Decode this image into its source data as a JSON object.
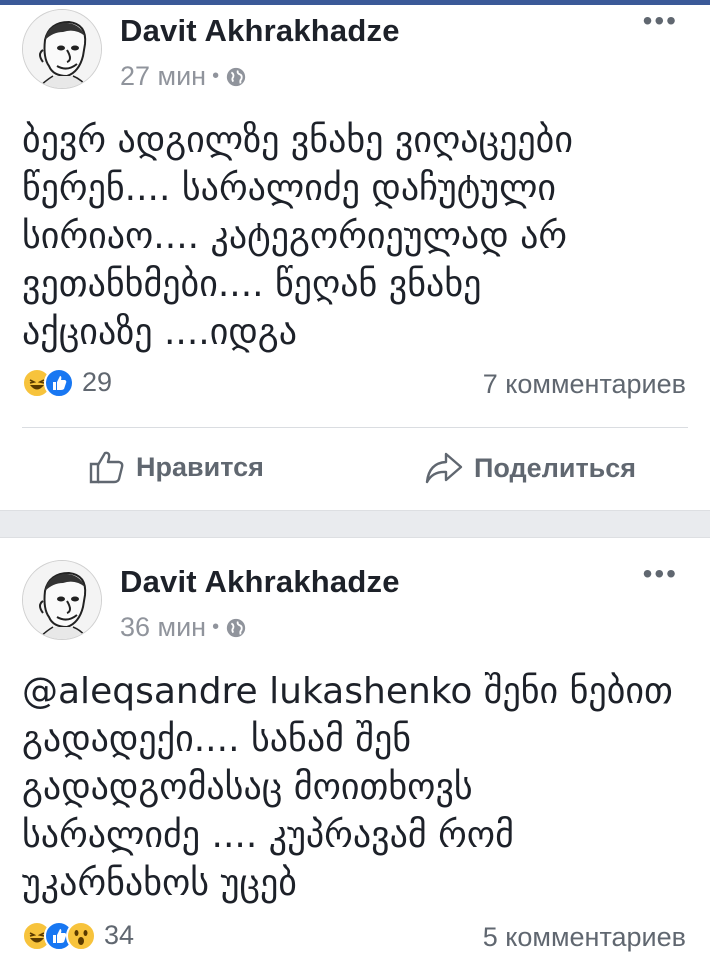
{
  "posts": [
    {
      "author": "Davit Akhrakhadze",
      "time": "27 мин",
      "privacy_separator": "•",
      "privacy_icon": "globe-icon",
      "more_icon": "more-dots-icon",
      "text": "ბევრ ადგილზე ვნახე  ვიღაცეები\nწერენ.... სარალიძე დაჩუტული\nსირიაო.... კატეგორიეულად არ\nვეთანხმები.... წეღან ვნახე\nაქციაზე ....იდგა",
      "reactions": [
        "haha",
        "like"
      ],
      "reaction_count": "29",
      "comments": "7 комментариев",
      "like_label": "Нравится",
      "share_label": "Поделиться"
    },
    {
      "author": "Davit Akhrakhadze",
      "time": "36 мин",
      "privacy_separator": "•",
      "privacy_icon": "globe-icon",
      "more_icon": "more-dots-icon",
      "text": "@aleqsandre lukashenko შენი ნებით\nგადადექი.... სანამ  შენ\nგადადგომასაც მოითხოვს\nსარალიძე .... კუპრავამ რომ\nუკარნახოს უცებ",
      "reactions": [
        "haha",
        "like",
        "wow"
      ],
      "reaction_count": "34",
      "comments": "5 комментариев"
    }
  ],
  "colors": {
    "brand": "#3b5998",
    "like_blue": "#1877f2",
    "reaction_yellow": "#f7c33c",
    "secondary_text": "#606770",
    "meta_text": "#90949c",
    "separator": "#e9ebee"
  }
}
